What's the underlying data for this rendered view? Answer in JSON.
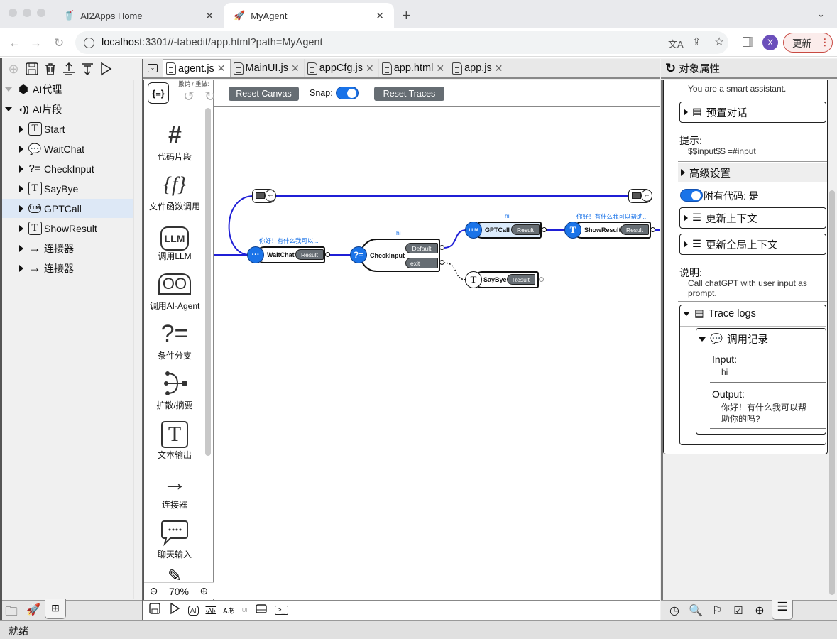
{
  "browser": {
    "tabs": [
      {
        "title": "AI2Apps Home",
        "icon": "cup-icon"
      },
      {
        "title": "MyAgent",
        "icon": "rocket-icon",
        "active": true
      }
    ],
    "new_tab": "+",
    "url_host": "localhost",
    "url_rest": ":3301//-tabedit/app.html?path=MyAgent",
    "profile_initial": "X",
    "update_label": "更新",
    "profile_color": "#6b4fbb"
  },
  "left_toolbar": [
    "add-icon",
    "save-icon",
    "delete-icon",
    "upload-icon",
    "download-icon",
    "run-icon"
  ],
  "tree": {
    "root": "AI代理",
    "group": "AI片段",
    "items": [
      {
        "label": "Start",
        "icon": "text-icon"
      },
      {
        "label": "WaitChat",
        "icon": "chat-icon"
      },
      {
        "label": "CheckInput",
        "icon": "condition-icon"
      },
      {
        "label": "SayBye",
        "icon": "text-icon"
      },
      {
        "label": "GPTCall",
        "icon": "llm-icon",
        "selected": true
      },
      {
        "label": "ShowResult",
        "icon": "text-icon"
      },
      {
        "label": "连接器",
        "icon": "arrow-icon"
      },
      {
        "label": "连接器",
        "icon": "arrow-icon"
      }
    ]
  },
  "editor_tabs": [
    {
      "label": "agent.js",
      "active": true
    },
    {
      "label": "MainUI.js"
    },
    {
      "label": "appCfg.js"
    },
    {
      "label": "app.html"
    },
    {
      "label": "app.js"
    }
  ],
  "undo_redo_label": "撤销 / 重做:",
  "canvas_toolbar": {
    "reset_canvas": "Reset Canvas",
    "snap_label": "Snap:",
    "snap_on": true,
    "reset_traces": "Reset Traces"
  },
  "palette": [
    {
      "label": "代码片段",
      "glyph": "#"
    },
    {
      "label": "文件函数调用",
      "glyph": "{f}"
    },
    {
      "label": "调用LLM",
      "glyph": "LLM"
    },
    {
      "label": "调用AI-Agent",
      "glyph": "OO"
    },
    {
      "label": "条件分支",
      "glyph": "?="
    },
    {
      "label": "扩散/摘要",
      "glyph": "⊰"
    },
    {
      "label": "文本输出",
      "glyph": "T"
    },
    {
      "label": "连接器",
      "glyph": "→"
    },
    {
      "label": "聊天输入",
      "glyph": "…"
    }
  ],
  "zoom_level": "70%",
  "flow": {
    "nodes": [
      {
        "name": "WaitChat",
        "port": "Result",
        "note": "你好！有什么我可以..."
      },
      {
        "name": "CheckInput",
        "ports": [
          "Default",
          "exit"
        ],
        "note": "hi"
      },
      {
        "name": "GPTCall",
        "port": "Result",
        "note": "hi"
      },
      {
        "name": "ShowResult",
        "port": "Result",
        "note": "你好！有什么我可以帮助..."
      },
      {
        "name": "SayBye",
        "port": "Result",
        "note": ""
      }
    ],
    "link_color": "#1f1fd6"
  },
  "editor_bottom_icons": [
    "save-icon",
    "run-icon",
    "ai-chat-icon",
    "ai-doc-icon",
    "translate-icon",
    "ui-ai-icon",
    "drive-icon",
    "terminal-icon"
  ],
  "properties": {
    "title": "对象属性",
    "system_value": "You are a smart assistant.",
    "preset_dialog": "预置对话",
    "prompt_label": "提示:",
    "prompt_value": "$$input$$ =#input",
    "advanced": "高级设置",
    "code_toggle_label": "附有代码: 是",
    "update_context": "更新上下文",
    "update_global_context": "更新全局上下文",
    "desc_label": "说明:",
    "desc_value": "Call chatGPT with user input as prompt.",
    "trace_logs": "Trace logs",
    "call_record": "调用记录",
    "input_label": "Input:",
    "input_value": "hi",
    "output_label": "Output:",
    "output_value": "你好！有什么我可以帮助你的吗?"
  },
  "right_bottom_icons": [
    "history-icon",
    "find-folder-icon",
    "flag-icon",
    "doc-check-icon",
    "globe-icon",
    "sliders-icon"
  ],
  "status": "就绪"
}
